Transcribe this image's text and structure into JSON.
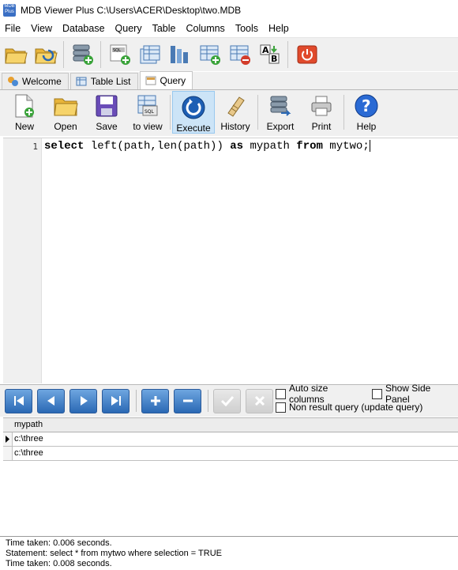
{
  "window": {
    "title": "MDB Viewer Plus C:\\Users\\ACER\\Desktop\\two.MDB",
    "logo_text": "MDB Plus"
  },
  "menu": [
    "File",
    "View",
    "Database",
    "Query",
    "Table",
    "Columns",
    "Tools",
    "Help"
  ],
  "tabs": [
    {
      "label": "Welcome",
      "icon": "welcome-icon"
    },
    {
      "label": "Table List",
      "icon": "table-list-icon"
    },
    {
      "label": "Query",
      "icon": "query-icon",
      "active": true
    }
  ],
  "query_toolbar": {
    "new": "New",
    "open": "Open",
    "save": "Save",
    "to_view": "to view",
    "execute": "Execute",
    "history": "History",
    "export": "Export",
    "print": "Print",
    "help": "Help"
  },
  "editor": {
    "line_number": "1",
    "tokens": [
      "select",
      " left(path,len(path)) ",
      "as",
      " mypath ",
      "from",
      " mytwo;"
    ]
  },
  "options": {
    "auto_size_columns": "Auto size columns",
    "show_side_panel": "Show Side Panel",
    "non_result_query": "Non result query (update query)"
  },
  "grid": {
    "column": "mypath",
    "rows": [
      "c:\\three",
      "c:\\three"
    ]
  },
  "status_lines": [
    "Time taken: 0.006 seconds.",
    "Statement: select * from mytwo where selection = TRUE",
    "Time taken: 0.008 seconds."
  ],
  "colors": {
    "nav_button": "#2a68b4",
    "active_button": "#cce4f7"
  }
}
